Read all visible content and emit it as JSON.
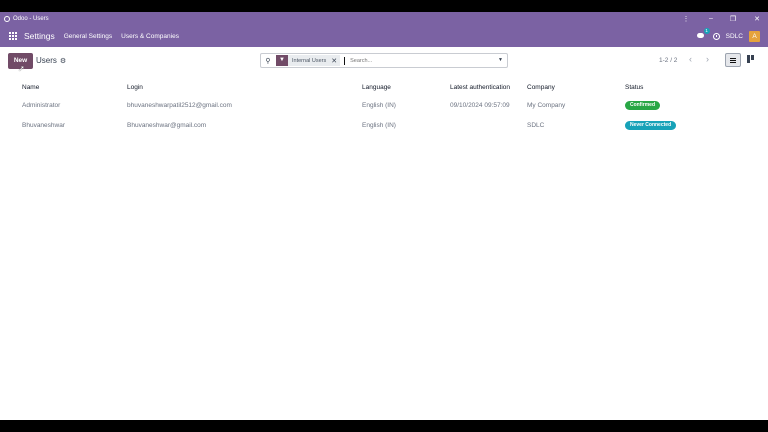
{
  "window": {
    "title": "Odoo - Users"
  },
  "navbar": {
    "app_name": "Settings",
    "links": [
      "General Settings",
      "Users & Companies"
    ],
    "chat_badge": "1",
    "company": "SDLC",
    "avatar_initial": "A"
  },
  "control": {
    "new_label": "New",
    "breadcrumb": "Users",
    "search": {
      "facet": "Internal Users",
      "placeholder": "Search..."
    },
    "pager": "1-2 / 2"
  },
  "table": {
    "headers": [
      "Name",
      "Login",
      "Language",
      "Latest authentication",
      "Company",
      "Status"
    ],
    "rows": [
      {
        "name": "Administrator",
        "login": "bhuvaneshwarpatil2512@gmail.com",
        "language": "English (IN)",
        "latest_auth": "09/10/2024 09:57:09",
        "company": "My Company",
        "status": "Confirmed",
        "status_color": "#28a745"
      },
      {
        "name": "Bhuvaneshwar",
        "login": "Bhuvaneshwar@gmail.com",
        "language": "English (IN)",
        "latest_auth": "",
        "company": "SDLC",
        "status": "Never Connected",
        "status_color": "#17a2b8"
      }
    ]
  },
  "colors": {
    "brand": "#7b62a3",
    "primary": "#714b67"
  }
}
